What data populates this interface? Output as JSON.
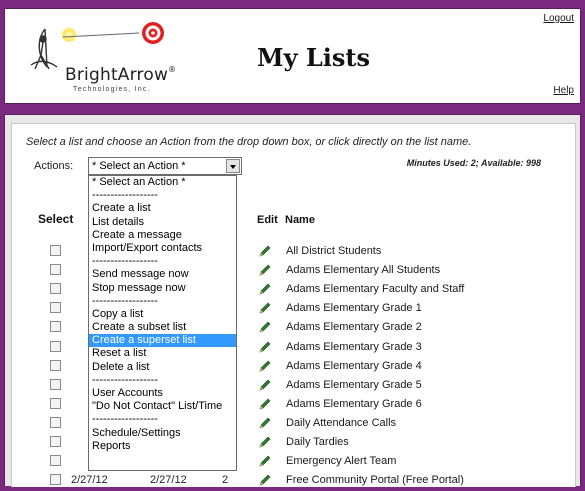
{
  "header": {
    "logo_text": "BrightArrow",
    "logo_trademark": "®",
    "logo_sub": "Technologies, Inc.",
    "title": "My Lists",
    "logout": "Logout",
    "help": "Help"
  },
  "toolbar": {
    "instructions": "Select a list and choose an Action from the drop down box, or click directly on the list name.",
    "actions_label": "Actions:",
    "selected_action": "* Select an Action *",
    "minutes": "Minutes Used: 2; Available: 998"
  },
  "table": {
    "columns": {
      "select": "Select",
      "edit": "Edit",
      "name": "Name"
    },
    "rows": [
      {
        "date1": "",
        "date2": "",
        "count": "",
        "name": "All District Students"
      },
      {
        "date1": "",
        "date2": "",
        "count": "",
        "name": "Adams Elementary All Students"
      },
      {
        "date1": "",
        "date2": "",
        "count": "",
        "name": "Adams Elementary Faculty and Staff"
      },
      {
        "date1": "",
        "date2": "",
        "count": "",
        "name": "Adams Elementary Grade 1"
      },
      {
        "date1": "",
        "date2": "",
        "count": "",
        "name": "Adams Elementary Grade 2"
      },
      {
        "date1": "",
        "date2": "",
        "count": "",
        "name": "Adams Elementary Grade 3"
      },
      {
        "date1": "",
        "date2": "",
        "count": "",
        "name": "Adams Elementary Grade 4"
      },
      {
        "date1": "",
        "date2": "",
        "count": "",
        "name": "Adams Elementary Grade 5"
      },
      {
        "date1": "",
        "date2": "",
        "count": "",
        "name": "Adams Elementary Grade 6"
      },
      {
        "date1": "",
        "date2": "",
        "count": "",
        "name": "Daily Attendance Calls"
      },
      {
        "date1": "",
        "date2": "",
        "count": "",
        "name": "Daily Tardies"
      },
      {
        "date1": "",
        "date2": "",
        "count": "",
        "name": "Emergency Alert Team"
      },
      {
        "date1": "2/27/12",
        "date2": "2/27/12",
        "count": "2",
        "name": "Free Community Portal (Free Portal)"
      }
    ]
  },
  "dropdown": {
    "options": [
      "* Select an Action *",
      "------------------",
      "Create a list",
      "List details",
      "Create a message",
      "Import/Export contacts",
      "------------------",
      "Send message now",
      "Stop message now",
      "------------------",
      "Copy a list",
      "Create a subset list",
      "Create a superset list",
      "Reset a list",
      "Delete a list",
      "------------------",
      "User Accounts",
      "\"Do Not Contact\" List/Time",
      "------------------",
      "Schedule/Settings",
      "Reports"
    ],
    "highlighted": "Create a superset list"
  },
  "colors": {
    "frame": "#7a2a7e",
    "highlight": "#3399ff",
    "pencil": "#2e7d2e"
  }
}
